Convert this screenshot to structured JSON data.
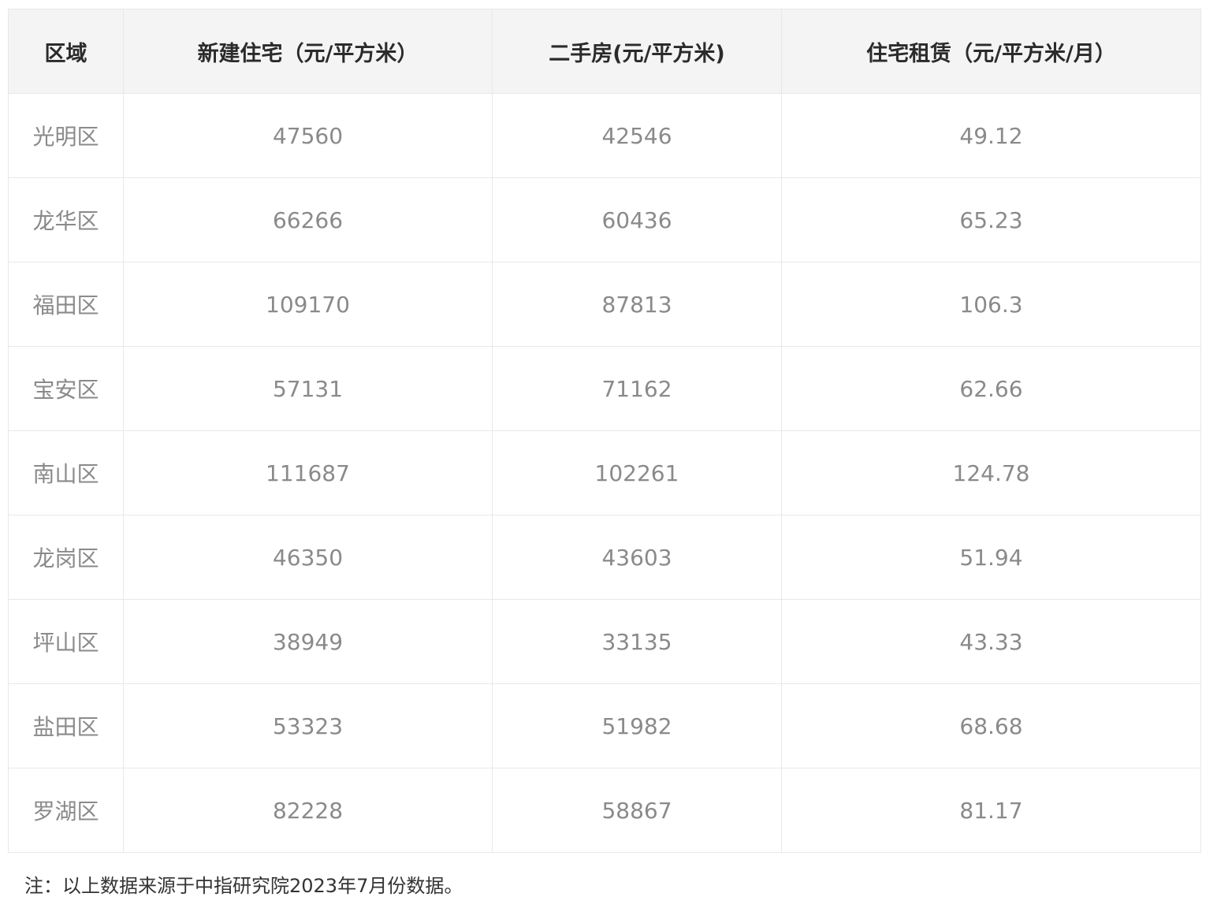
{
  "table": {
    "headers": [
      "区域",
      "新建住宅（元/平方米）",
      "二手房(元/平方米)",
      "住宅租赁（元/平方米/月）"
    ],
    "rows": [
      [
        "光明区",
        "47560",
        "42546",
        "49.12"
      ],
      [
        "龙华区",
        "66266",
        "60436",
        "65.23"
      ],
      [
        "福田区",
        "109170",
        "87813",
        "106.3"
      ],
      [
        "宝安区",
        "57131",
        "71162",
        "62.66"
      ],
      [
        "南山区",
        "111687",
        "102261",
        "124.78"
      ],
      [
        "龙岗区",
        "46350",
        "43603",
        "51.94"
      ],
      [
        "坪山区",
        "38949",
        "33135",
        "43.33"
      ],
      [
        "盐田区",
        "53323",
        "51982",
        "68.68"
      ],
      [
        "罗湖区",
        "82228",
        "58867",
        "81.17"
      ]
    ]
  },
  "note": "注：以上数据来源于中指研究院2023年7月份数据。"
}
